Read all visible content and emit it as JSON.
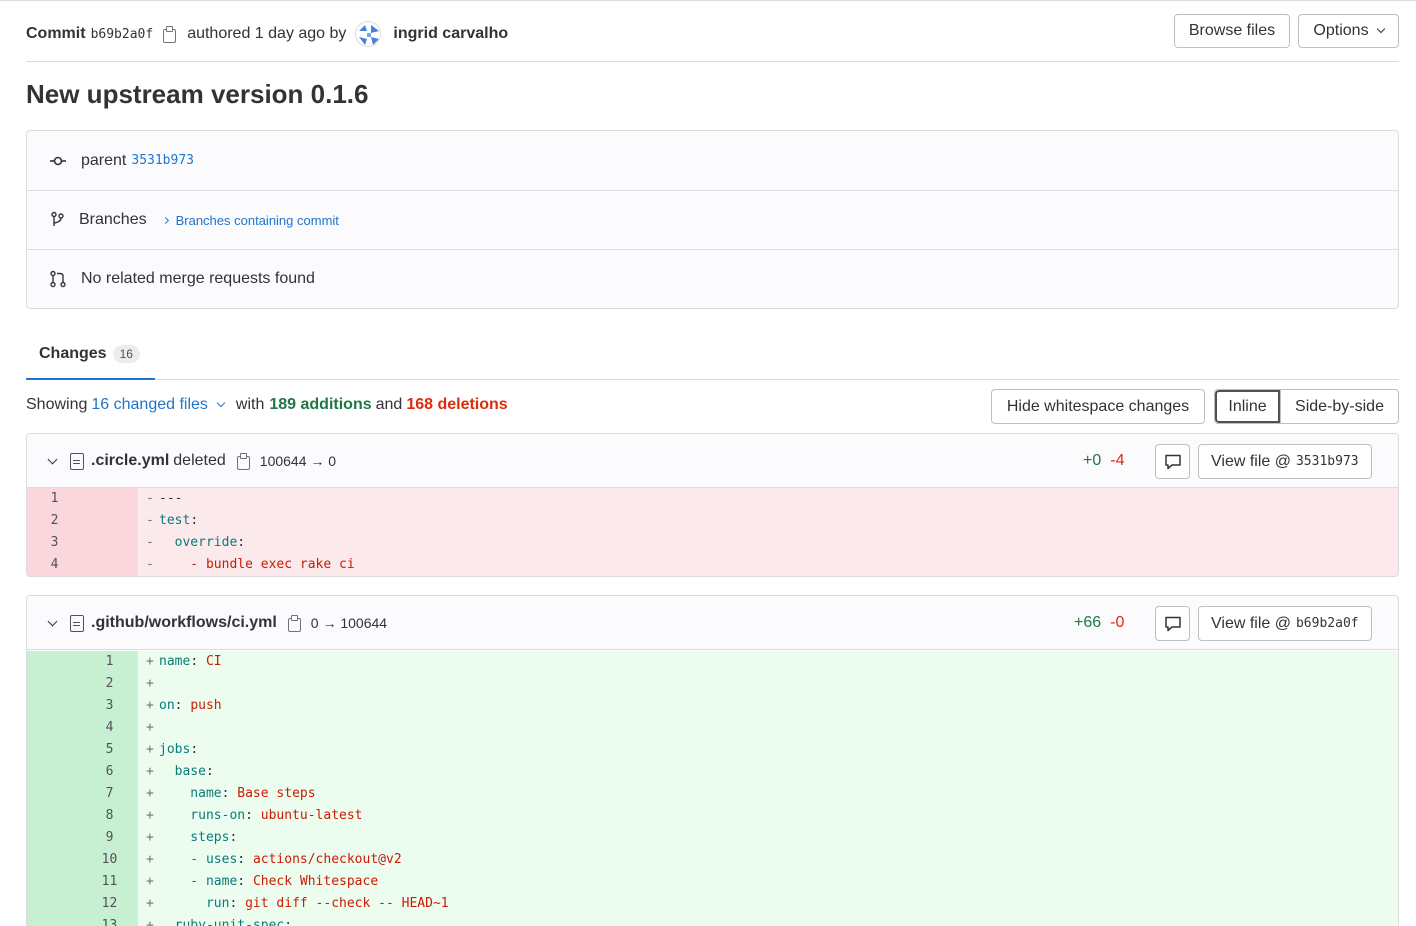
{
  "header": {
    "commit_label": "Commit",
    "commit_sha": "b69b2a0f",
    "authored_text": "authored 1 day ago by",
    "author": "ingrid carvalho",
    "browse_files": "Browse files",
    "options": "Options"
  },
  "title": "New upstream version 0.1.6",
  "info": {
    "parent_label": "parent",
    "parent_sha": "3531b973",
    "branches_label": "Branches",
    "branches_link": "Branches containing commit",
    "merge_requests": "No related merge requests found"
  },
  "tabs": [
    {
      "label": "Changes",
      "count": "16"
    }
  ],
  "summary": {
    "showing": "Showing",
    "changed_files": "16 changed files",
    "with": "with",
    "additions": "189 additions",
    "and": "and",
    "deletions": "168 deletions",
    "hide_whitespace": "Hide whitespace changes",
    "inline": "Inline",
    "side_by_side": "Side-by-side"
  },
  "files": [
    {
      "name": ".circle.yml",
      "status": "deleted",
      "mode": "100644 → 0",
      "additions": "+0",
      "deletions": "-4",
      "view_label": "View file @",
      "view_sha": "3531b973",
      "lines": [
        {
          "old": "1",
          "new": "",
          "sign": "-",
          "key": "",
          "text": "---"
        },
        {
          "old": "2",
          "new": "",
          "sign": "-",
          "key": "test",
          "text": ":"
        },
        {
          "old": "3",
          "new": "",
          "sign": "-",
          "key": "  override",
          "text": ":"
        },
        {
          "old": "4",
          "new": "",
          "sign": "-",
          "key": "",
          "text": "    - bundle exec rake ci"
        }
      ]
    },
    {
      "name": ".github/workflows/ci.yml",
      "status": "",
      "mode": "0 → 100644",
      "additions": "+66",
      "deletions": "-0",
      "view_label": "View file @",
      "view_sha": "b69b2a0f",
      "lines": [
        {
          "old": "",
          "new": "1",
          "sign": "+",
          "key": "name",
          "text": "CI"
        },
        {
          "old": "",
          "new": "2",
          "sign": "+",
          "key": "",
          "text": ""
        },
        {
          "old": "",
          "new": "3",
          "sign": "+",
          "key": "on",
          "text": "push"
        },
        {
          "old": "",
          "new": "4",
          "sign": "+",
          "key": "",
          "text": ""
        },
        {
          "old": "",
          "new": "5",
          "sign": "+",
          "key": "jobs",
          "text": ""
        },
        {
          "old": "",
          "new": "6",
          "sign": "+",
          "key": "  base",
          "text": ""
        },
        {
          "old": "",
          "new": "7",
          "sign": "+",
          "key": "    name",
          "text": "Base steps"
        },
        {
          "old": "",
          "new": "8",
          "sign": "+",
          "key": "    runs-on",
          "text": "ubuntu-latest"
        },
        {
          "old": "",
          "new": "9",
          "sign": "+",
          "key": "    steps",
          "text": ""
        },
        {
          "old": "",
          "new": "10",
          "sign": "+",
          "key": "    - uses",
          "text": "actions/checkout@v2"
        },
        {
          "old": "",
          "new": "11",
          "sign": "+",
          "key": "    - name",
          "text": "Check Whitespace"
        },
        {
          "old": "",
          "new": "12",
          "sign": "+",
          "key": "      run",
          "text": "git diff --check -- HEAD~1"
        },
        {
          "old": "",
          "new": "13",
          "sign": "+",
          "key": "  ruby-unit-spec",
          "text": ""
        }
      ]
    }
  ]
}
